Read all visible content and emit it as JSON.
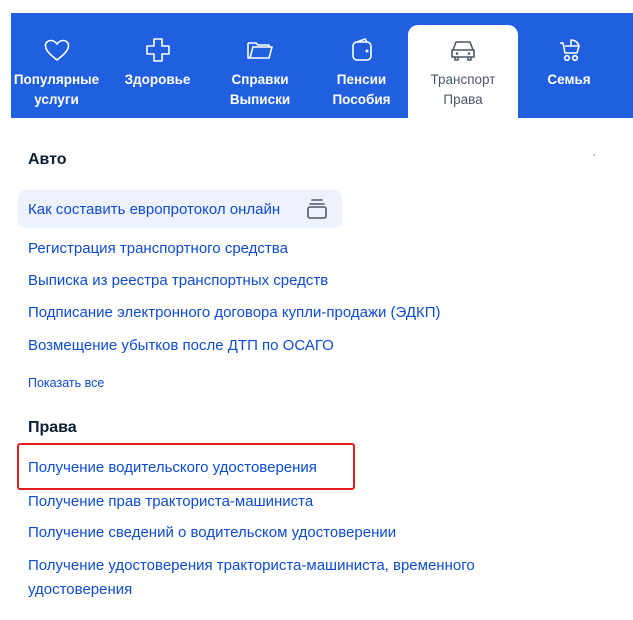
{
  "tabs": [
    {
      "line1": "Популярные",
      "line2": "услуги",
      "icon": "heart-icon"
    },
    {
      "line1": "Здоровье",
      "line2": "",
      "icon": "cross-icon"
    },
    {
      "line1": "Справки",
      "line2": "Выписки",
      "icon": "folder-icon"
    },
    {
      "line1": "Пенсии",
      "line2": "Пособия",
      "icon": "wallet-icon"
    },
    {
      "line1": "Транспорт",
      "line2": "Права",
      "icon": "car-icon",
      "active": true
    },
    {
      "line1": "Семья",
      "line2": "",
      "icon": "stroller-icon"
    }
  ],
  "colors": {
    "tabbar": "#1f5fe0",
    "link": "#0d4cd3",
    "highlight": "#e0201e",
    "active_tab_text": "#4d5766"
  },
  "auto": {
    "title": "Авто",
    "links": [
      "Как составить европротокол онлайн",
      "Регистрация транспортного средства",
      "Выписка из реестра транспортных средств",
      "Подписание электронного договора купли-продажи (ЭДКП)",
      "Возмещение убытков после ДТП по ОСАГО"
    ],
    "show_all": "Показать все"
  },
  "prava": {
    "title": "Права",
    "links": [
      "Получение водительского удостоверения",
      "Получение прав тракториста-машиниста",
      "Получение сведений о водительском удостоверении",
      "Получение удостоверения тракториста-машиниста, временного удостоверения"
    ]
  }
}
